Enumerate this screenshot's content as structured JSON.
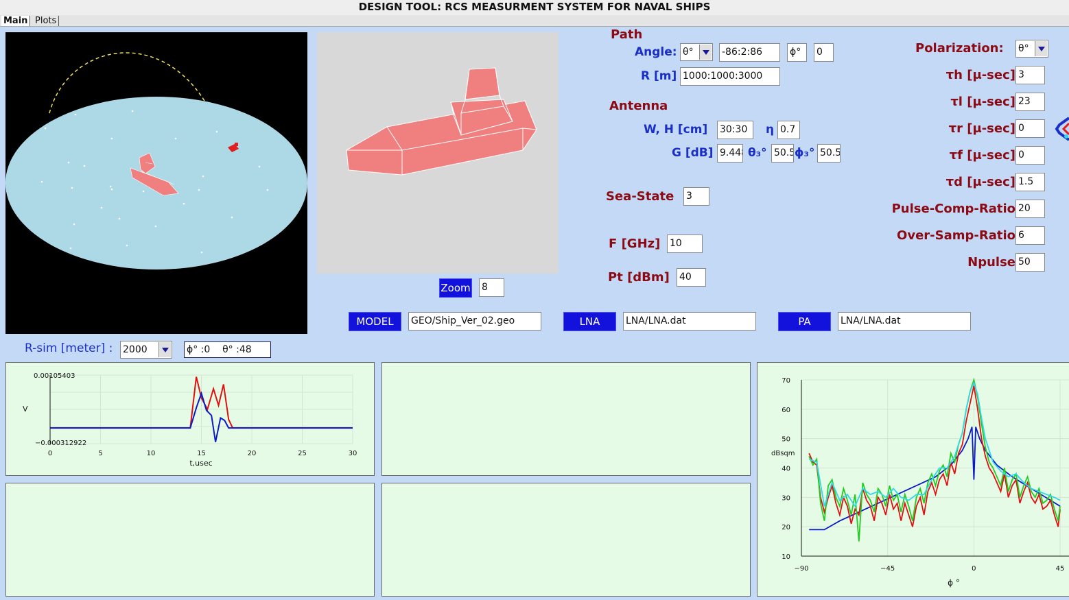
{
  "window": {
    "title": "DESIGN TOOL: RCS MEASURMENT SYSTEM FOR NAVAL SHIPS"
  },
  "tabs": [
    {
      "label": "Main",
      "active": true
    },
    {
      "label": "Plots",
      "active": false
    }
  ],
  "scene_view": {
    "background": "#000000",
    "sea_color": "#add8e6",
    "ship_color": "#f08080"
  },
  "model_view": {
    "background": "#d8d8d8",
    "ship_color": "#f08080"
  },
  "zoom": {
    "label": "Zoom",
    "value": "8"
  },
  "files": {
    "model": {
      "label": "MODEL",
      "value": "GEO/Ship_Ver_02.geo"
    },
    "lna": {
      "label": "LNA",
      "value": "LNA/LNA.dat"
    },
    "pa": {
      "label": "PA",
      "value": "LNA/LNA.dat"
    }
  },
  "path": {
    "header": "Path",
    "angle_label": "Angle:",
    "angle_axis": "θ°",
    "angle_range": "-86:2:86",
    "phi_label": "ϕ°",
    "phi_value": "0",
    "r_label": "R [m]",
    "r_value": "1000:1000:3000"
  },
  "antenna": {
    "header": "Antenna",
    "wh_label": "W, H [cm]",
    "wh_value": "30:30",
    "eta_label": "η",
    "eta_value": "0.7",
    "g_label": "G [dB]",
    "g_value": "9.448",
    "theta3_label": "θ₃°",
    "theta3_value": "50.5",
    "phi3_label": "ϕ₃°",
    "phi3_value": "50.5"
  },
  "sea_state": {
    "label": "Sea-State",
    "value": "3"
  },
  "freq": {
    "label": "F [GHz]",
    "value": "10"
  },
  "pt": {
    "label": "Pt [dBm]",
    "value": "40"
  },
  "polarization": {
    "label": "Polarization:",
    "value": "θ°"
  },
  "params": [
    {
      "label": "τh [μ-sec]",
      "value": "3"
    },
    {
      "label": "τl [μ-sec]",
      "value": "23"
    },
    {
      "label": "τr [μ-sec]",
      "value": "0"
    },
    {
      "label": "τf [μ-sec]",
      "value": "0"
    },
    {
      "label": "τd [μ-sec]",
      "value": "1.5"
    },
    {
      "label": "Pulse-Comp-Ratio",
      "value": "20"
    },
    {
      "label": "Over-Samp-Ratio",
      "value": "6"
    },
    {
      "label": "Npulse",
      "value": "50"
    }
  ],
  "rsim": {
    "label": "R-sim [meter] :",
    "value": "2000",
    "angles_readout": "ϕ° :0    θ° :48"
  },
  "colors": {
    "series_red": "#e01010",
    "series_blue": "#0a1ac8",
    "series_green": "#22cc22",
    "series_cyan": "#30d8e8",
    "panel_bg": "#e6fbe6"
  },
  "plot_time": {
    "y_label": "V",
    "x_label": "t,usec",
    "y_top_label": "0.00105403",
    "y_bottom_label": "−0.000312922",
    "xlim": [
      0,
      30
    ],
    "ylim": [
      -0.000312922,
      0.00105403
    ],
    "x_ticks": [
      "0",
      "5",
      "10",
      "15",
      "20",
      "25",
      "30"
    ]
  },
  "plot_rcs": {
    "y_label": "dBsqm",
    "x_label": "ϕ °",
    "xlim": [
      -90,
      50
    ],
    "ylim": [
      10,
      70
    ],
    "x_ticks": [
      "−90",
      "−45",
      "0",
      "45"
    ],
    "y_ticks": [
      "10",
      "20",
      "30",
      "40",
      "50",
      "60",
      "70"
    ]
  },
  "chart_data": [
    {
      "type": "line",
      "xlabel": "t,usec",
      "ylabel": "V",
      "xlim": [
        0,
        30
      ],
      "ylim": [
        -0.000312922,
        0.00105403
      ],
      "grid": true,
      "series": [
        {
          "color": "#e01010",
          "x": [
            0,
            13.9,
            14.5,
            15.0,
            15.6,
            16.2,
            16.7,
            17.2,
            17.7,
            18.1,
            30
          ],
          "y": [
            0,
            0,
            0.00102,
            0.0006,
            0.00037,
            0.00078,
            0.00045,
            0.00087,
            0.00017,
            0,
            0
          ]
        },
        {
          "color": "#0a1ac8",
          "x": [
            0,
            13.9,
            14.5,
            15.0,
            15.5,
            16.0,
            16.4,
            16.9,
            17.3,
            17.7,
            30
          ],
          "y": [
            0,
            0,
            0.0004,
            0.00069,
            0.00035,
            0.00025,
            -0.00028,
            0.0002,
            0.00015,
            0,
            0
          ]
        }
      ]
    },
    {
      "type": "line",
      "xlabel": "ϕ °",
      "ylabel": "dBsqm",
      "xlim": [
        -90,
        50
      ],
      "ylim": [
        10,
        70
      ],
      "grid": true,
      "series": [
        {
          "color": "#0a1ac8",
          "x": [
            -86,
            -78,
            -70,
            -60,
            -50,
            -40,
            -30,
            -20,
            -12,
            -6,
            -3,
            -1,
            0,
            1,
            3,
            6,
            12,
            20,
            30,
            40,
            45
          ],
          "y": [
            19,
            19,
            22,
            25,
            28,
            31,
            34,
            37,
            41,
            46,
            50,
            54,
            36,
            54,
            50,
            46,
            41,
            37,
            33,
            29,
            27
          ]
        },
        {
          "color": "#e01010",
          "x": [
            -86,
            -84,
            -82,
            -80,
            -78,
            -76,
            -74,
            -72,
            -70,
            -68,
            -66,
            -64,
            -62,
            -60,
            -58,
            -56,
            -54,
            -52,
            -50,
            -48,
            -46,
            -44,
            -42,
            -40,
            -38,
            -36,
            -34,
            -32,
            -30,
            -28,
            -26,
            -24,
            -22,
            -20,
            -18,
            -16,
            -14,
            -12,
            -10,
            -8,
            -6,
            -4,
            -2,
            0,
            2,
            4,
            6,
            8,
            10,
            12,
            14,
            16,
            18,
            20,
            22,
            24,
            26,
            28,
            30,
            32,
            34,
            36,
            38,
            40,
            42,
            44,
            45
          ],
          "y": [
            45,
            42,
            41,
            30,
            25,
            30,
            34,
            28,
            24,
            30,
            27,
            21,
            26,
            24,
            33,
            29,
            27,
            22,
            30,
            28,
            24,
            31,
            26,
            28,
            22,
            28,
            24,
            20,
            27,
            30,
            24,
            32,
            35,
            31,
            36,
            38,
            34,
            42,
            38,
            45,
            48,
            56,
            62,
            68,
            60,
            50,
            44,
            40,
            38,
            35,
            32,
            38,
            30,
            34,
            36,
            28,
            32,
            35,
            30,
            28,
            31,
            26,
            27,
            29,
            24,
            20,
            26
          ]
        },
        {
          "color": "#22cc22",
          "x": [
            -86,
            -84,
            -82,
            -80,
            -78,
            -76,
            -74,
            -72,
            -70,
            -68,
            -66,
            -64,
            -62,
            -60,
            -58,
            -56,
            -54,
            -52,
            -50,
            -48,
            -46,
            -44,
            -42,
            -40,
            -38,
            -36,
            -34,
            -32,
            -30,
            -28,
            -26,
            -24,
            -22,
            -20,
            -18,
            -16,
            -14,
            -12,
            -10,
            -8,
            -6,
            -4,
            -2,
            0,
            2,
            4,
            6,
            8,
            10,
            12,
            14,
            16,
            18,
            20,
            22,
            24,
            26,
            28,
            30,
            32,
            34,
            36,
            38,
            40,
            42,
            44,
            45
          ],
          "y": [
            44,
            41,
            43,
            28,
            22,
            34,
            36,
            30,
            27,
            33,
            29,
            24,
            31,
            15,
            35,
            31,
            29,
            25,
            33,
            31,
            27,
            34,
            29,
            31,
            25,
            31,
            27,
            22,
            30,
            33,
            28,
            35,
            38,
            34,
            39,
            41,
            37,
            45,
            42,
            48,
            52,
            60,
            66,
            70,
            64,
            55,
            47,
            42,
            40,
            37,
            34,
            40,
            32,
            36,
            38,
            30,
            34,
            37,
            32,
            30,
            33,
            28,
            29,
            31,
            26,
            22,
            27
          ]
        },
        {
          "color": "#30d8e8",
          "x": [
            -86,
            -82,
            -78,
            -74,
            -70,
            -66,
            -62,
            -58,
            -54,
            -50,
            -46,
            -42,
            -38,
            -34,
            -30,
            -26,
            -22,
            -18,
            -14,
            -10,
            -6,
            -4,
            -2,
            0,
            2,
            4,
            6,
            10,
            14,
            18,
            22,
            26,
            30,
            34,
            38,
            42,
            45
          ],
          "y": [
            43,
            42,
            27,
            35,
            29,
            31,
            27,
            33,
            31,
            32,
            30,
            33,
            30,
            29,
            31,
            31,
            36,
            40,
            40,
            44,
            52,
            60,
            66,
            69,
            65,
            57,
            50,
            42,
            39,
            37,
            38,
            35,
            33,
            32,
            31,
            30,
            29
          ]
        }
      ]
    }
  ]
}
